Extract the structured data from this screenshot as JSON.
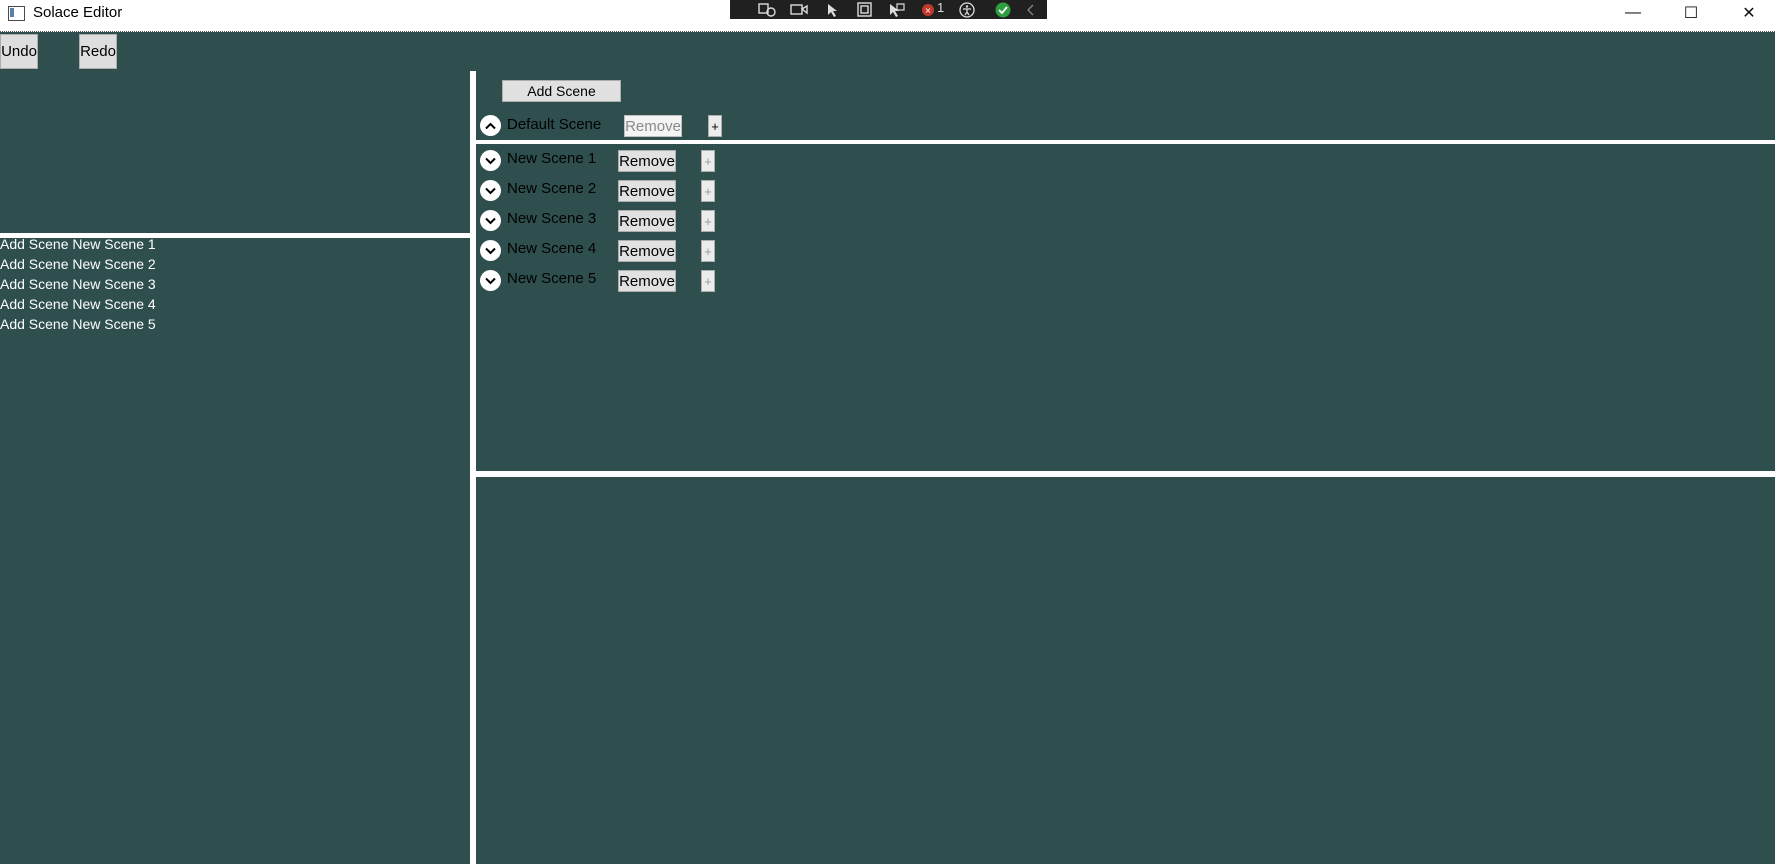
{
  "window": {
    "title": "Solace Editor",
    "minimize": "—",
    "maximize": "☐",
    "close": "✕"
  },
  "debug_toolbar": {
    "counter": "1",
    "icons": [
      "live-visual-tree-icon",
      "record-icon",
      "select-element-icon",
      "display-layout-adorners-icon",
      "track-focus-icon",
      "binding-failures-icon",
      "accessibility-icon",
      "check-icon",
      "collapse-icon"
    ]
  },
  "toolbar": {
    "undo_label": "Undo",
    "redo_label": "Redo"
  },
  "log": {
    "lines": [
      "Add Scene New Scene 1",
      "Add Scene New Scene 2",
      "Add Scene New Scene 3",
      "Add Scene New Scene 4",
      "Add Scene New Scene 5"
    ]
  },
  "scenes": {
    "add_label": "Add Scene",
    "remove_label": "Remove",
    "plus_label": "+",
    "default_scene": {
      "name": "Default Scene",
      "expanded": true,
      "remove_enabled": false
    },
    "items": [
      {
        "name": "New Scene 1",
        "expanded": false
      },
      {
        "name": "New Scene 2",
        "expanded": false
      },
      {
        "name": "New Scene 3",
        "expanded": false
      },
      {
        "name": "New Scene 4",
        "expanded": false
      },
      {
        "name": "New Scene 5",
        "expanded": false
      }
    ]
  },
  "colors": {
    "background": "#2f4f4f",
    "splitter": "#ffffff"
  }
}
